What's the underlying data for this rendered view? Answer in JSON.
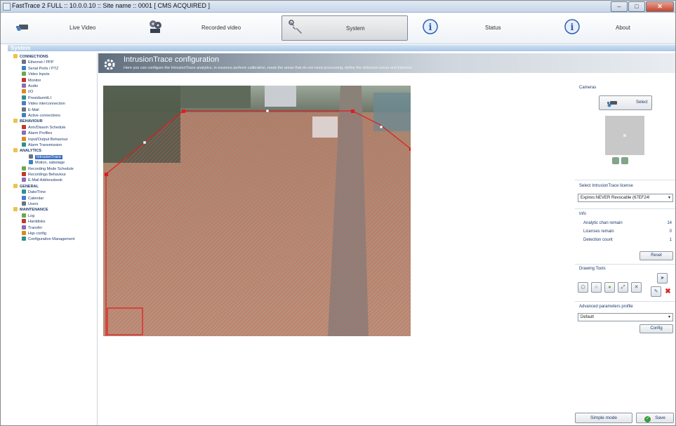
{
  "window": {
    "title": "FastTrace 2 FULL :: 10.0.0.10 :: Site name :: 0001 [ CMS ACQUIRED ]"
  },
  "nav": [
    {
      "label": "Live Video",
      "icon": "camera-icon"
    },
    {
      "label": "Recorded video",
      "icon": "film-reel-icon"
    },
    {
      "label": "System",
      "icon": "wrench-icon",
      "active": true
    },
    {
      "label": "Status",
      "icon": "info-icon"
    },
    {
      "label": "About",
      "icon": "info-icon"
    }
  ],
  "section_title": "System",
  "sidebar": {
    "items": [
      {
        "label": "CONNECTIONS",
        "type": "category"
      },
      {
        "label": "Ethernet / PPP"
      },
      {
        "label": "Serial Ports / PTZ"
      },
      {
        "label": "Video Inputs"
      },
      {
        "label": "Monitor"
      },
      {
        "label": "Audio"
      },
      {
        "label": "I/O"
      },
      {
        "label": "PresidiumHLI"
      },
      {
        "label": "Video interconnection"
      },
      {
        "label": "E-Mail"
      },
      {
        "label": "Active connections"
      },
      {
        "label": "BEHAVIOUR",
        "type": "category"
      },
      {
        "label": "Arm/Disarm Schedule"
      },
      {
        "label": "Alarm Profiles"
      },
      {
        "label": "Input/Output Behaviour"
      },
      {
        "label": "Alarm Transmission"
      },
      {
        "label": "ANALYTICS",
        "type": "category"
      },
      {
        "label": "IntrusionTrace",
        "selected": true
      },
      {
        "label": "Motion, sabotage"
      },
      {
        "label": "Recording Mode Schedule"
      },
      {
        "label": "Recordings Behaviour"
      },
      {
        "label": "E-Mail Addressbook"
      },
      {
        "label": "GENERAL",
        "type": "category"
      },
      {
        "label": "Date/Time"
      },
      {
        "label": "Calendar"
      },
      {
        "label": "Users"
      },
      {
        "label": "MAINTENANCE",
        "type": "category"
      },
      {
        "label": "Log"
      },
      {
        "label": "Harddisks"
      },
      {
        "label": "Transfer"
      },
      {
        "label": "Hqs config"
      },
      {
        "label": "Configuration Management"
      }
    ]
  },
  "content": {
    "title": "IntrusionTrace configuration",
    "description": "Here you can configure the IntrusionTrace analytics, in essence perform calibration, mask the areas that do not need processing, define the detection areas and tripwires."
  },
  "panel": {
    "cameras_label": "Cameras",
    "select_button": "Select",
    "license_label": "Select IntrusionTrace license",
    "license_value": "Expires:NEVER Revocable (67EF24!",
    "info_label": "Info",
    "info_rows": [
      {
        "label": "Analytic chan remain",
        "value": "14"
      },
      {
        "label": "Licenses remain",
        "value": "0"
      },
      {
        "label": "Detection count",
        "value": "1"
      }
    ],
    "reset_button": "Reset",
    "drawing_tools_label": "Drawing Tools",
    "advanced_label": "Advanced parameters profile",
    "advanced_value": "Default",
    "config_button": "Config"
  },
  "footer": {
    "simple_mode_button": "Simple mode",
    "save_button": "Save"
  },
  "colors": {
    "accent": "#3a6fc4",
    "detection_outline": "#e21b1b",
    "hatch": "#d85a5a"
  }
}
